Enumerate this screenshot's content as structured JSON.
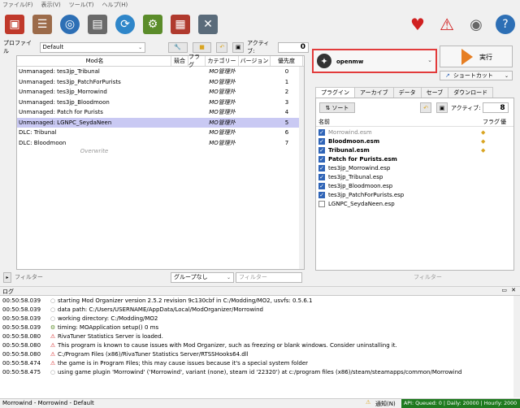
{
  "menu": [
    "ファイル(F)",
    "表示(V)",
    "ツール(T)",
    "ヘルプ(H)"
  ],
  "toolbar": {
    "icons": [
      "install-mod-icon",
      "profiles-icon",
      "nexus-icon",
      "ini-editor-icon",
      "refresh-icon",
      "executables-icon",
      "tools-icon",
      "settings-icon"
    ],
    "right_icons": [
      "heart-icon",
      "warning-icon",
      "update-icon",
      "help-icon"
    ]
  },
  "profile": {
    "label": "プロファイル",
    "value": "Default",
    "active_label": "アクティブ:",
    "active_count": "0"
  },
  "modlist": {
    "columns": [
      "Mod名",
      "競合",
      "フラグ",
      "カテゴリー",
      "バージョン",
      "優先度"
    ],
    "rows": [
      {
        "name": "Unmanaged: tes3jp_Tribunal",
        "category": "MO管理外",
        "priority": "0"
      },
      {
        "name": "Unmanaged: tes3jp_PatchForPurists",
        "category": "MO管理外",
        "priority": "1"
      },
      {
        "name": "Unmanaged: tes3jp_Morrowind",
        "category": "MO管理外",
        "priority": "2"
      },
      {
        "name": "Unmanaged: tes3jp_Bloodmoon",
        "category": "MO管理外",
        "priority": "3"
      },
      {
        "name": "Unmanaged: Patch for Purists",
        "category": "MO管理外",
        "priority": "4"
      },
      {
        "name": "Unmanaged: LGNPC_SeydaNeen",
        "category": "MO管理外",
        "priority": "5"
      },
      {
        "name": "DLC: Tribunal",
        "category": "MO管理外",
        "priority": "6"
      },
      {
        "name": "DLC: Bloodmoon",
        "category": "MO管理外",
        "priority": "7"
      }
    ],
    "overwrite": "Overwrite",
    "filter_label": "フィルター",
    "group_value": "グループなし",
    "filter_placeholder": "フィルター"
  },
  "executable": {
    "name": "openmw",
    "run_label": "実行",
    "shortcut_label": "ショートカット"
  },
  "tabs": [
    "プラグイン",
    "アーカイブ",
    "データ",
    "セーブ",
    "ダウンロード"
  ],
  "plugins": {
    "sort_label": "ソート",
    "active_label": "アクティブ:",
    "active_count": "8",
    "col_name": "名前",
    "col_flag": "フラグ",
    "col_priority": "優",
    "rows": [
      {
        "name": "Morrowind.esm",
        "checked": true,
        "style": "gray",
        "flag": true
      },
      {
        "name": "Bloodmoon.esm",
        "checked": true,
        "style": "bold",
        "flag": true
      },
      {
        "name": "Tribunal.esm",
        "checked": true,
        "style": "bold",
        "flag": true
      },
      {
        "name": "Patch for Purists.esm",
        "checked": true,
        "style": "bold",
        "flag": false
      },
      {
        "name": "tes3jp_Morrowind.esp",
        "checked": true,
        "style": "normal",
        "flag": false
      },
      {
        "name": "tes3jp_Tribunal.esp",
        "checked": true,
        "style": "normal",
        "flag": false
      },
      {
        "name": "tes3jp_Bloodmoon.esp",
        "checked": true,
        "style": "normal",
        "flag": false
      },
      {
        "name": "tes3jp_PatchForPurists.esp",
        "checked": true,
        "style": "normal",
        "flag": false
      },
      {
        "name": "LGNPC_SeydaNeen.esp",
        "checked": false,
        "style": "normal",
        "flag": false
      }
    ],
    "filter_placeholder": "フィルター"
  },
  "log": {
    "title": "ログ",
    "rows": [
      {
        "time": "00:50:58.039",
        "level": "info",
        "msg": "starting Mod Organizer version 2.5.2 revision 9c130cbf in C:/Modding/MO2, usvfs: 0.5.6.1"
      },
      {
        "time": "00:50:58.039",
        "level": "info",
        "msg": "data path: C:/Users/USERNAME/AppData/Local/ModOrganizer/Morrowind"
      },
      {
        "time": "00:50:58.039",
        "level": "info",
        "msg": "working directory: C:/Modding/MO2"
      },
      {
        "time": "00:50:58.039",
        "level": "debug",
        "msg": "timing: MOApplication setup() 0 ms"
      },
      {
        "time": "00:50:58.080",
        "level": "warn",
        "msg": "RivaTuner Statistics Server is loaded."
      },
      {
        "time": "00:50:58.080",
        "level": "warn",
        "msg": "This program is known to cause issues with Mod Organizer, such as freezing or blank windows. Consider uninstalling it."
      },
      {
        "time": "00:50:58.080",
        "level": "warn",
        "msg": "C:/Program Files (x86)/RivaTuner Statistics Server/RTSSHooks64.dll"
      },
      {
        "time": "00:50:58.474",
        "level": "warn",
        "msg": "the game is in Program Files; this may cause issues because it's a special system folder"
      },
      {
        "time": "00:50:58.475",
        "level": "info",
        "msg": "using game plugin 'Morrowind' ('Morrowind', variant (none), steam id '22320') at c:/program files (x86)/steam/steamapps/common/Morrowind"
      }
    ]
  },
  "status": {
    "left": "Morrowind - Morrowind - Default",
    "notify": "通知(N)",
    "api": "API: Queued: 0 | Daily: 20000 | Hourly: 2000"
  },
  "colors": {
    "accent": "#2f64b7",
    "highlight": "#e23b3b",
    "selected_row": "#c9c9f3",
    "api_bg": "#1f7a1f"
  }
}
